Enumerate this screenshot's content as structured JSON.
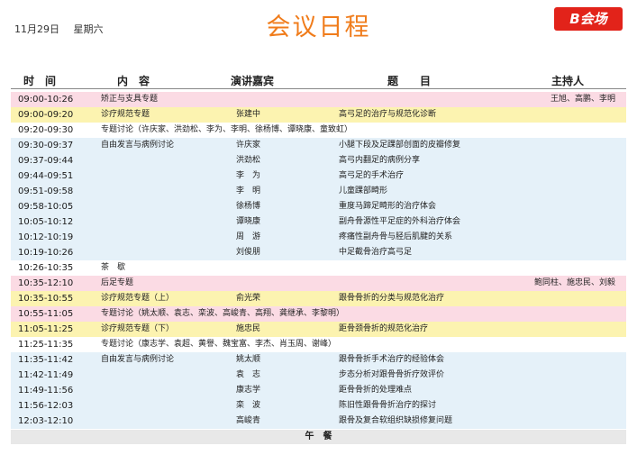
{
  "header": {
    "date": "11月29日",
    "weekday": "星期六",
    "title": "会议日程",
    "venue": "B会场"
  },
  "columns": {
    "time": "时　间",
    "topic": "内　容",
    "speaker": "演讲嘉宾",
    "subject": "题　　目",
    "host": "主持人"
  },
  "rows": [
    {
      "style": "pink",
      "time": "09:00-10:26",
      "topic": "矫正与支具专题",
      "speaker": "",
      "subject": "",
      "host": "王旭、高鹏、李明"
    },
    {
      "style": "yellow",
      "time": "09:00-09:20",
      "topic": "诊疗规范专题",
      "speaker": "张建中",
      "subject": "高弓足的治疗与规范化诊断",
      "host": ""
    },
    {
      "style": "white",
      "time": "09:20-09:30",
      "topic": "专题讨论（许庆家、洪劲松、李为、李明、徐杨博、谭晓康、童致虹）",
      "speaker": "",
      "subject": "",
      "host": ""
    },
    {
      "style": "blue",
      "time": "09:30-09:37",
      "topic": "自由发言与病例讨论",
      "speaker": "许庆家",
      "subject": "小腿下段及足踝部创面的皮瓣修复",
      "host": ""
    },
    {
      "style": "blue",
      "time": "09:37-09:44",
      "topic": "",
      "speaker": "洪劲松",
      "subject": "高弓内翻足的病例分享",
      "host": ""
    },
    {
      "style": "blue",
      "time": "09:44-09:51",
      "topic": "",
      "speaker": "李　为",
      "subject": "高弓足的手术治疗",
      "host": ""
    },
    {
      "style": "blue",
      "time": "09:51-09:58",
      "topic": "",
      "speaker": "李　明",
      "subject": "儿童踝部畸形",
      "host": ""
    },
    {
      "style": "blue",
      "time": "09:58-10:05",
      "topic": "",
      "speaker": "徐杨博",
      "subject": "重度马蹄足畸形的治疗体会",
      "host": ""
    },
    {
      "style": "blue",
      "time": "10:05-10:12",
      "topic": "",
      "speaker": "谭晓康",
      "subject": "副舟骨源性平足症的外科治疗体会",
      "host": ""
    },
    {
      "style": "blue",
      "time": "10:12-10:19",
      "topic": "",
      "speaker": "周　游",
      "subject": "疼痛性副舟骨与胫后肌腱的关系",
      "host": ""
    },
    {
      "style": "blue",
      "time": "10:19-10:26",
      "topic": "",
      "speaker": "刘俊朋",
      "subject": "中足截骨治疗高弓足",
      "host": ""
    },
    {
      "style": "white",
      "time": "10:26-10:35",
      "topic": "茶　歇",
      "speaker": "",
      "subject": "",
      "host": ""
    },
    {
      "style": "pink",
      "time": "10:35-12:10",
      "topic": "后足专题",
      "speaker": "",
      "subject": "",
      "host": "鲍同柱、施忠民、刘毅"
    },
    {
      "style": "yellow",
      "time": "10:35-10:55",
      "topic": "诊疗规范专题（上）",
      "speaker": "俞光荣",
      "subject": "跟骨骨折的分类与规范化治疗",
      "host": ""
    },
    {
      "style": "pink",
      "time": "10:55-11:05",
      "topic": "专题讨论（姚太顺、袁志、栾波、高峻青、高翔、龚继承、李黎明）",
      "speaker": "",
      "subject": "",
      "host": ""
    },
    {
      "style": "yellow",
      "time": "11:05-11:25",
      "topic": "诊疗规范专题（下）",
      "speaker": "施忠民",
      "subject": "距骨颈骨折的规范化治疗",
      "host": ""
    },
    {
      "style": "white",
      "time": "11:25-11:35",
      "topic": "专题讨论（康志学、袁超、黄譽、魏宝富、李杰、肖玉周、谢峰）",
      "speaker": "",
      "subject": "",
      "host": ""
    },
    {
      "style": "blue",
      "time": "11:35-11:42",
      "topic": "自由发言与病例讨论",
      "speaker": "姚太顺",
      "subject": "跟骨骨折手术治疗的经验体会",
      "host": ""
    },
    {
      "style": "blue",
      "time": "11:42-11:49",
      "topic": "",
      "speaker": "袁　志",
      "subject": "步态分析对跟骨骨折疗效评价",
      "host": ""
    },
    {
      "style": "blue",
      "time": "11:49-11:56",
      "topic": "",
      "speaker": "康志学",
      "subject": "距骨骨折的处理难点",
      "host": ""
    },
    {
      "style": "blue",
      "time": "11:56-12:03",
      "topic": "",
      "speaker": "栾　波",
      "subject": "陈旧性跟骨骨折治疗的探讨",
      "host": ""
    },
    {
      "style": "blue",
      "time": "12:03-12:10",
      "topic": "",
      "speaker": "高峻青",
      "subject": "跟骨及复合软组织缺损修复问题",
      "host": ""
    }
  ],
  "footer": {
    "lunch": "午　餐"
  }
}
